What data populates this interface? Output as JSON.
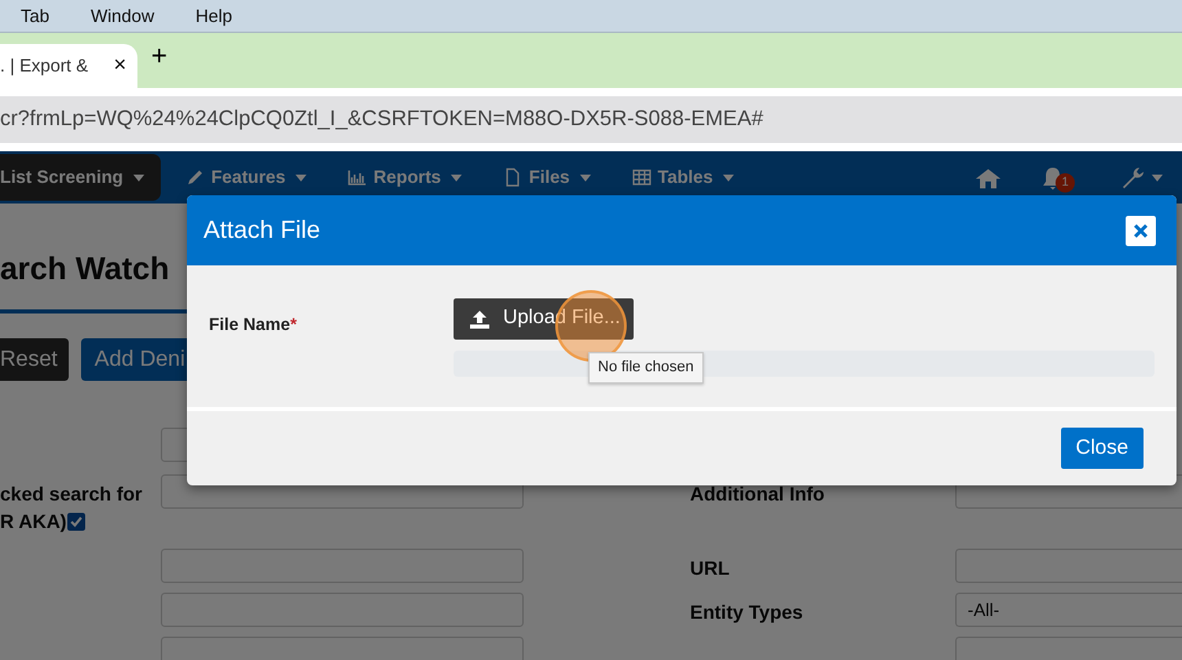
{
  "menu_bar": [
    "Tab",
    "Window",
    "Help"
  ],
  "browser_tab": {
    "title": ". | Export &",
    "close": "×"
  },
  "new_tab": "+",
  "address": "cr?frmLp=WQ%24%24ClpCQ0Ztl_I_&CSRFTOKEN=M88O-DX5R-S088-EMEA#",
  "navbar": {
    "items": [
      {
        "label": "List Screening",
        "current": true
      },
      {
        "label": "Features",
        "current": false
      },
      {
        "label": "Reports",
        "current": false
      },
      {
        "label": "Files",
        "current": false
      },
      {
        "label": "Tables",
        "current": false
      }
    ],
    "badge": "1"
  },
  "page": {
    "heading": "arch Watch",
    "buttons": [
      {
        "label": "Reset",
        "kind": "dark"
      },
      {
        "label": "Add Deni",
        "kind": "primary"
      }
    ],
    "form_rows": [
      {
        "left": {
          "kind": "text"
        }
      },
      {
        "left": {
          "kind": "text",
          "label": [
            "cked search for",
            "R AKA)"
          ],
          "checked": true
        },
        "right": {
          "label": "Additional Info",
          "kind": "text"
        }
      },
      {
        "left": {
          "kind": "text"
        },
        "right": {
          "label": "URL",
          "kind": "text"
        }
      },
      {
        "left": {
          "kind": "text"
        },
        "right": {
          "label": "Entity Types",
          "kind": "select",
          "value": "-All-"
        }
      },
      {
        "left": {
          "kind": "text"
        },
        "right": {
          "kind": "text"
        }
      }
    ]
  },
  "modal": {
    "title": "Attach File",
    "field_label": "File Name",
    "required_mark": "*",
    "upload_button": "Upload File...",
    "tooltip": "No file chosen",
    "footer_button": "Close"
  }
}
